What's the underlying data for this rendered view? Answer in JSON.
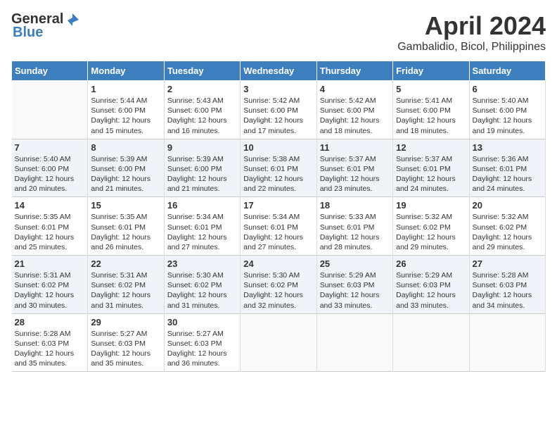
{
  "header": {
    "logo_general": "General",
    "logo_blue": "Blue",
    "month": "April 2024",
    "location": "Gambalidio, Bicol, Philippines"
  },
  "days_of_week": [
    "Sunday",
    "Monday",
    "Tuesday",
    "Wednesday",
    "Thursday",
    "Friday",
    "Saturday"
  ],
  "weeks": [
    [
      {
        "day": "",
        "info": ""
      },
      {
        "day": "1",
        "info": "Sunrise: 5:44 AM\nSunset: 6:00 PM\nDaylight: 12 hours\nand 15 minutes."
      },
      {
        "day": "2",
        "info": "Sunrise: 5:43 AM\nSunset: 6:00 PM\nDaylight: 12 hours\nand 16 minutes."
      },
      {
        "day": "3",
        "info": "Sunrise: 5:42 AM\nSunset: 6:00 PM\nDaylight: 12 hours\nand 17 minutes."
      },
      {
        "day": "4",
        "info": "Sunrise: 5:42 AM\nSunset: 6:00 PM\nDaylight: 12 hours\nand 18 minutes."
      },
      {
        "day": "5",
        "info": "Sunrise: 5:41 AM\nSunset: 6:00 PM\nDaylight: 12 hours\nand 18 minutes."
      },
      {
        "day": "6",
        "info": "Sunrise: 5:40 AM\nSunset: 6:00 PM\nDaylight: 12 hours\nand 19 minutes."
      }
    ],
    [
      {
        "day": "7",
        "info": "Sunrise: 5:40 AM\nSunset: 6:00 PM\nDaylight: 12 hours\nand 20 minutes."
      },
      {
        "day": "8",
        "info": "Sunrise: 5:39 AM\nSunset: 6:00 PM\nDaylight: 12 hours\nand 21 minutes."
      },
      {
        "day": "9",
        "info": "Sunrise: 5:39 AM\nSunset: 6:00 PM\nDaylight: 12 hours\nand 21 minutes."
      },
      {
        "day": "10",
        "info": "Sunrise: 5:38 AM\nSunset: 6:01 PM\nDaylight: 12 hours\nand 22 minutes."
      },
      {
        "day": "11",
        "info": "Sunrise: 5:37 AM\nSunset: 6:01 PM\nDaylight: 12 hours\nand 23 minutes."
      },
      {
        "day": "12",
        "info": "Sunrise: 5:37 AM\nSunset: 6:01 PM\nDaylight: 12 hours\nand 24 minutes."
      },
      {
        "day": "13",
        "info": "Sunrise: 5:36 AM\nSunset: 6:01 PM\nDaylight: 12 hours\nand 24 minutes."
      }
    ],
    [
      {
        "day": "14",
        "info": "Sunrise: 5:35 AM\nSunset: 6:01 PM\nDaylight: 12 hours\nand 25 minutes."
      },
      {
        "day": "15",
        "info": "Sunrise: 5:35 AM\nSunset: 6:01 PM\nDaylight: 12 hours\nand 26 minutes."
      },
      {
        "day": "16",
        "info": "Sunrise: 5:34 AM\nSunset: 6:01 PM\nDaylight: 12 hours\nand 27 minutes."
      },
      {
        "day": "17",
        "info": "Sunrise: 5:34 AM\nSunset: 6:01 PM\nDaylight: 12 hours\nand 27 minutes."
      },
      {
        "day": "18",
        "info": "Sunrise: 5:33 AM\nSunset: 6:01 PM\nDaylight: 12 hours\nand 28 minutes."
      },
      {
        "day": "19",
        "info": "Sunrise: 5:32 AM\nSunset: 6:02 PM\nDaylight: 12 hours\nand 29 minutes."
      },
      {
        "day": "20",
        "info": "Sunrise: 5:32 AM\nSunset: 6:02 PM\nDaylight: 12 hours\nand 29 minutes."
      }
    ],
    [
      {
        "day": "21",
        "info": "Sunrise: 5:31 AM\nSunset: 6:02 PM\nDaylight: 12 hours\nand 30 minutes."
      },
      {
        "day": "22",
        "info": "Sunrise: 5:31 AM\nSunset: 6:02 PM\nDaylight: 12 hours\nand 31 minutes."
      },
      {
        "day": "23",
        "info": "Sunrise: 5:30 AM\nSunset: 6:02 PM\nDaylight: 12 hours\nand 31 minutes."
      },
      {
        "day": "24",
        "info": "Sunrise: 5:30 AM\nSunset: 6:02 PM\nDaylight: 12 hours\nand 32 minutes."
      },
      {
        "day": "25",
        "info": "Sunrise: 5:29 AM\nSunset: 6:03 PM\nDaylight: 12 hours\nand 33 minutes."
      },
      {
        "day": "26",
        "info": "Sunrise: 5:29 AM\nSunset: 6:03 PM\nDaylight: 12 hours\nand 33 minutes."
      },
      {
        "day": "27",
        "info": "Sunrise: 5:28 AM\nSunset: 6:03 PM\nDaylight: 12 hours\nand 34 minutes."
      }
    ],
    [
      {
        "day": "28",
        "info": "Sunrise: 5:28 AM\nSunset: 6:03 PM\nDaylight: 12 hours\nand 35 minutes."
      },
      {
        "day": "29",
        "info": "Sunrise: 5:27 AM\nSunset: 6:03 PM\nDaylight: 12 hours\nand 35 minutes."
      },
      {
        "day": "30",
        "info": "Sunrise: 5:27 AM\nSunset: 6:03 PM\nDaylight: 12 hours\nand 36 minutes."
      },
      {
        "day": "",
        "info": ""
      },
      {
        "day": "",
        "info": ""
      },
      {
        "day": "",
        "info": ""
      },
      {
        "day": "",
        "info": ""
      }
    ]
  ]
}
